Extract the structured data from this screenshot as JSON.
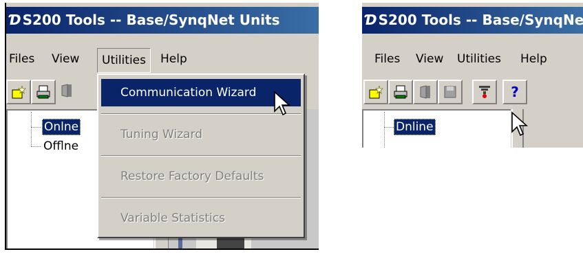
{
  "left_window": {
    "title": "S200 Tools -- Base/SynqNet Units",
    "menu": {
      "files": "Files",
      "view": "View",
      "utilities": "Utilities",
      "help": "Help"
    },
    "tree": {
      "online": "Onlne",
      "offline": "Offlne"
    },
    "dropdown": {
      "items": [
        {
          "label": "Communication Wizard",
          "state": "highlighted"
        },
        {
          "label": "Tuning Wizard",
          "state": "disabled"
        },
        {
          "label": "Restore Factory Defaults",
          "state": "disabled"
        },
        {
          "label": "Variable Statistics",
          "state": "disabled"
        }
      ]
    }
  },
  "right_window": {
    "title": "S200 Tools -- Base/SynqNet",
    "menu": {
      "files": "Files",
      "view": "View",
      "utilities": "Utilities",
      "help": "Help"
    },
    "toolbar": {
      "help_glyph": "?",
      "buttons": [
        "new-icon",
        "print-icon",
        "exit-icon",
        "save-icon",
        "communication-wizard-icon",
        "help-icon"
      ]
    },
    "tree": {
      "online": "Dnline"
    }
  },
  "colors": {
    "title_gradient_start": "#0a246a",
    "title_gradient_end": "#3a6ea5",
    "face": "#d4d0c8",
    "selection": "#0a246a"
  }
}
